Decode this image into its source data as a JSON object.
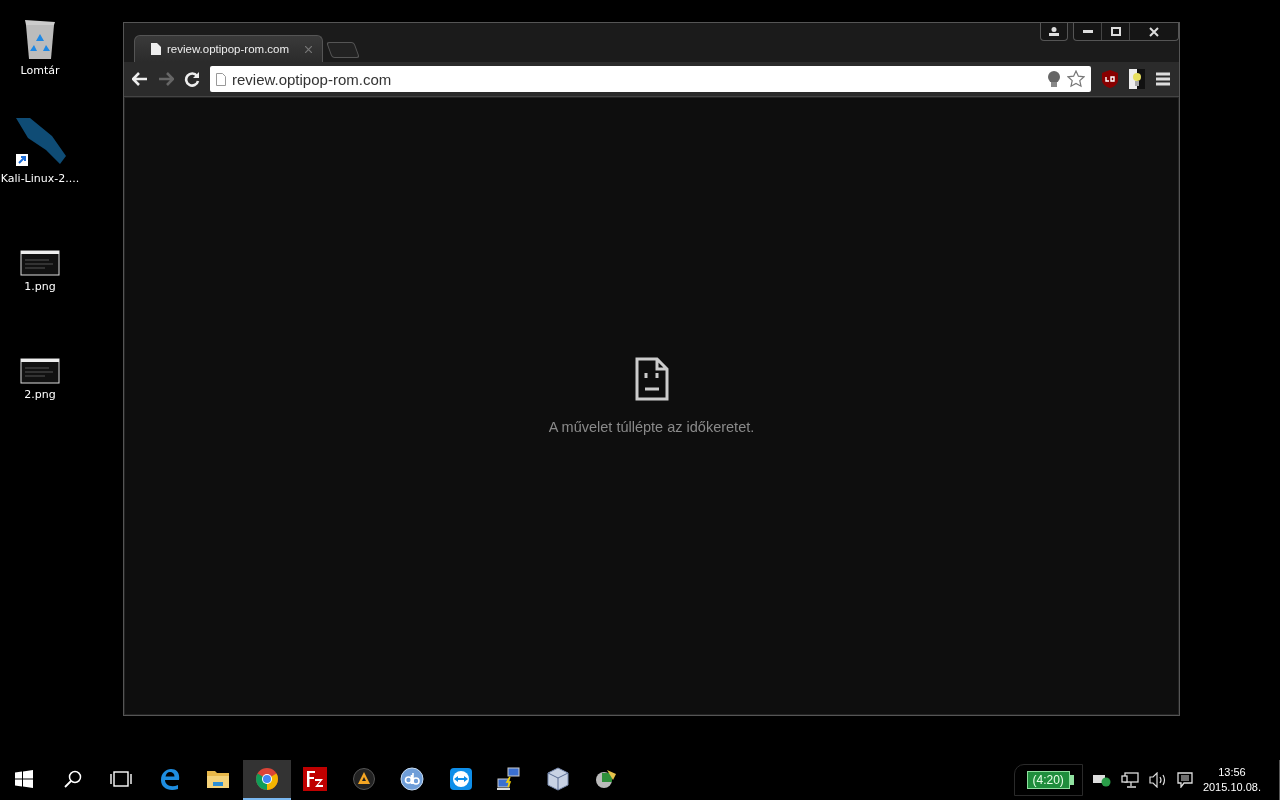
{
  "desktop_icons": [
    {
      "kind": "recycle",
      "label": "Lomtár"
    },
    {
      "kind": "shortcut",
      "label": "Kali-Linux-2...."
    },
    {
      "kind": "image",
      "label": "1.png"
    },
    {
      "kind": "image",
      "label": "2.png"
    }
  ],
  "browser": {
    "tabs": [
      {
        "title": "review.optipop-rom.com",
        "selected": true
      }
    ],
    "address": {
      "value": "review.optipop-rom.com"
    },
    "error": {
      "message": "A művelet túllépte az időkeretet."
    }
  },
  "taskbar": {
    "apps": [
      {
        "kind": "start",
        "selected": false
      },
      {
        "kind": "search",
        "selected": false
      },
      {
        "kind": "taskview",
        "selected": false
      },
      {
        "kind": "edge",
        "selected": false
      },
      {
        "kind": "folder",
        "selected": false
      },
      {
        "kind": "chrome",
        "selected": true
      },
      {
        "kind": "filezilla",
        "selected": false
      },
      {
        "kind": "aimp",
        "selected": false
      },
      {
        "kind": "qbittorrent",
        "selected": false
      },
      {
        "kind": "teamviewer",
        "selected": false
      },
      {
        "kind": "network",
        "selected": false
      },
      {
        "kind": "virtualbox",
        "selected": false
      },
      {
        "kind": "tool",
        "selected": false
      }
    ],
    "battery": "(4:20)",
    "time": "13:56",
    "date": "2015.10.08."
  }
}
